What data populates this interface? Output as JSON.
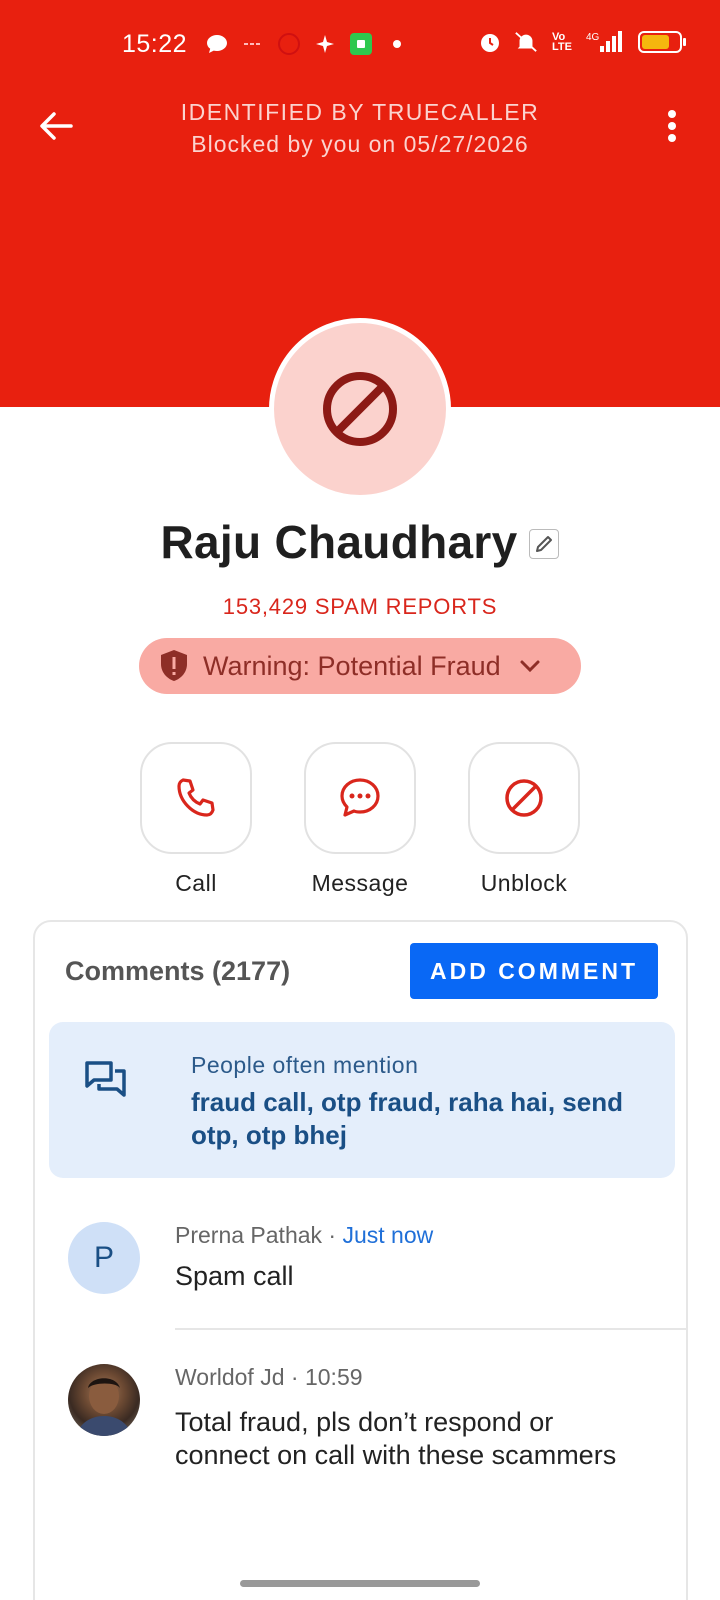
{
  "status_bar": {
    "time": "15:22",
    "icons": [
      "chat-icon",
      "data-icon",
      "record-icon",
      "sparkle-icon",
      "app-icon",
      "dot-icon",
      "alarm-icon",
      "mute-icon",
      "volte-icon",
      "signal-icon",
      "battery-icon"
    ],
    "battery_fraction": 0.75
  },
  "header": {
    "background": "#e8200f",
    "identified_label": "IDENTIFIED BY TRUECALLER",
    "blocked_label": "Blocked by you on 05/27/2026"
  },
  "contact": {
    "name": "Raju Chaudhary",
    "spam_reports": "153,429 SPAM REPORTS",
    "warning": "Warning: Potential Fraud"
  },
  "actions": [
    {
      "label": "Call",
      "icon": "phone-icon"
    },
    {
      "label": "Message",
      "icon": "message-icon"
    },
    {
      "label": "Unblock",
      "icon": "block-icon"
    }
  ],
  "comments": {
    "title": "Comments (2177)",
    "add_button": "ADD COMMENT",
    "mention_label": "People often mention",
    "mention_text": "fraud call, otp fraud, raha hai, send otp, otp bhej",
    "items": [
      {
        "initial": "P",
        "author": "Prerna Pathak",
        "sep": " · ",
        "time": "Just now",
        "text": "Spam call"
      },
      {
        "initial": "",
        "author": "Worldof Jd",
        "sep": " · ",
        "time": "10:59",
        "text": "Total fraud, pls don’t respond or connect on call with these scammers"
      }
    ]
  }
}
